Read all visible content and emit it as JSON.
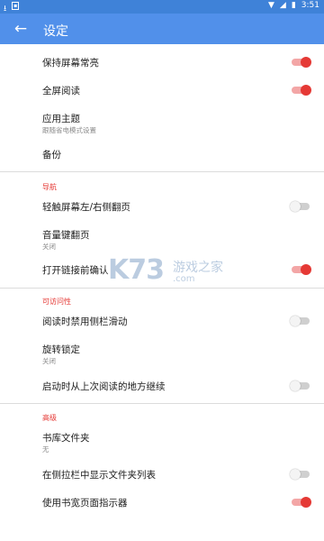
{
  "status_bar": {
    "time": "3:51"
  },
  "app_bar": {
    "title": "设定"
  },
  "sections": {
    "nav": "导航",
    "accessibility": "可访问性",
    "advanced": "高级"
  },
  "rows": {
    "keep_screen_on": {
      "label": "保持屏幕常亮",
      "on": true
    },
    "fullscreen_reading": {
      "label": "全屏阅读",
      "on": true
    },
    "app_theme": {
      "label": "应用主题",
      "sub": "跟随省电模式设置"
    },
    "backup": {
      "label": "备份"
    },
    "tap_page_turn": {
      "label": "轻触屏幕左/右侧翻页",
      "on": false
    },
    "volume_keys": {
      "label": "音量键翻页",
      "sub": "关闭"
    },
    "confirm_links": {
      "label": "打开链接前确认",
      "on": true
    },
    "disable_sidebar_swipe": {
      "label": "阅读时禁用侧栏滑动",
      "on": false
    },
    "rotation_lock": {
      "label": "旋转锁定",
      "sub": "关闭"
    },
    "resume_reading": {
      "label": "启动时从上次阅读的地方继续",
      "on": false
    },
    "library_folder": {
      "label": "书库文件夹",
      "sub": "无"
    },
    "show_folder_list": {
      "label": "在侧拉栏中显示文件夹列表",
      "on": false
    },
    "page_indicator": {
      "label": "使用书宽页面指示器",
      "on": true
    }
  },
  "watermark": {
    "logo": "K73",
    "cn": "游戏之家",
    "domain": ".com"
  },
  "colors": {
    "statusbar": "#3f82d8",
    "appbar": "#5190ea",
    "accent": "#e53935"
  }
}
